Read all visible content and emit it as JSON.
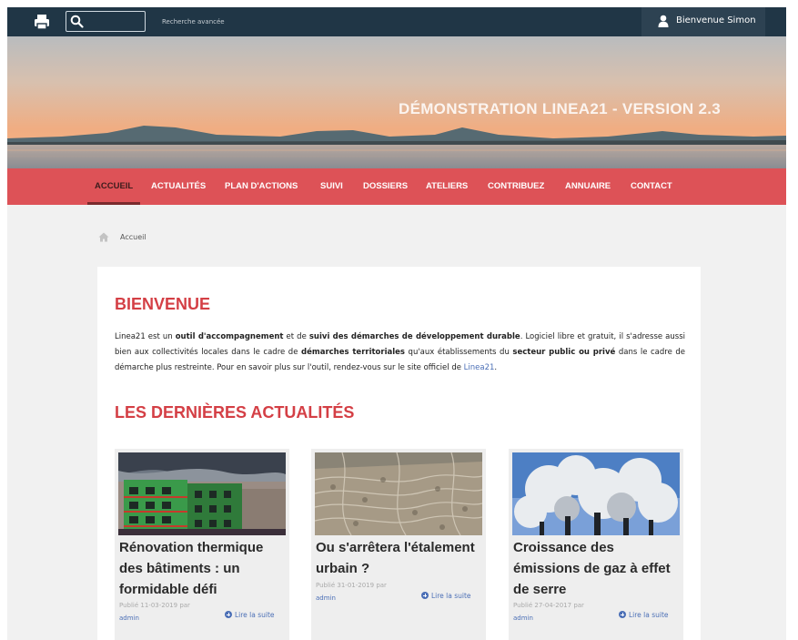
{
  "topbar": {
    "print_icon": "print-icon",
    "search_icon": "search-icon",
    "search_value": "",
    "advanced_search": "Recherche avancée",
    "user_icon": "user-icon",
    "welcome": "Bienvenue Simon"
  },
  "banner": {
    "title": "DÉMONSTRATION LINEA21 - VERSION 2.3"
  },
  "nav": {
    "items": [
      "ACCUEIL",
      "ACTUALITÉS",
      "PLAN D'ACTIONS",
      "SUIVI",
      "DOSSIERS",
      "ATELIERS",
      "CONTRIBUEZ",
      "ANNUAIRE",
      "CONTACT"
    ],
    "active": "ACCUEIL"
  },
  "breadcrumb": {
    "icon": "home-icon",
    "label": "Accueil"
  },
  "welcome": {
    "title": "BIENVENUE",
    "text_1": "Linea21 est un ",
    "bold_1": "outil d'accompagnement",
    "text_2": " et de ",
    "bold_2": "suivi des démarches de développement durable",
    "text_3": ". Logiciel libre et gratuit, il s'adresse aussi bien aux collectivités locales dans le cadre de ",
    "bold_3": "démarches territoriales",
    "text_4": " qu'aux établissements du ",
    "bold_4": "secteur public ou privé",
    "text_5": " dans le cadre de démarche plus restreinte. Pour en savoir plus sur l'outil, rendez-vous sur le site officiel de ",
    "link": "Linea21",
    "text_6": "."
  },
  "news": {
    "title": "LES DERNIÈRES ACTUALITÉS",
    "read_more": "Lire la suite",
    "by": "par",
    "items": [
      {
        "title": "Rénovation thermique des bâtiments : un formidable défi",
        "date": "Publié 11-03-2019",
        "author": "admin"
      },
      {
        "title": "Ou s'arrêtera l'étalement urbain ?",
        "date": "Publié 31-01-2019",
        "author": "admin"
      },
      {
        "title": "Croissance des émissions de gaz à effet de serre",
        "date": "Publié 27-04-2017",
        "author": "admin"
      }
    ]
  },
  "colors": {
    "topbar": "#203646",
    "nav": "#dd5257",
    "accent_title": "#d43f45",
    "link": "#4b6fb6"
  }
}
